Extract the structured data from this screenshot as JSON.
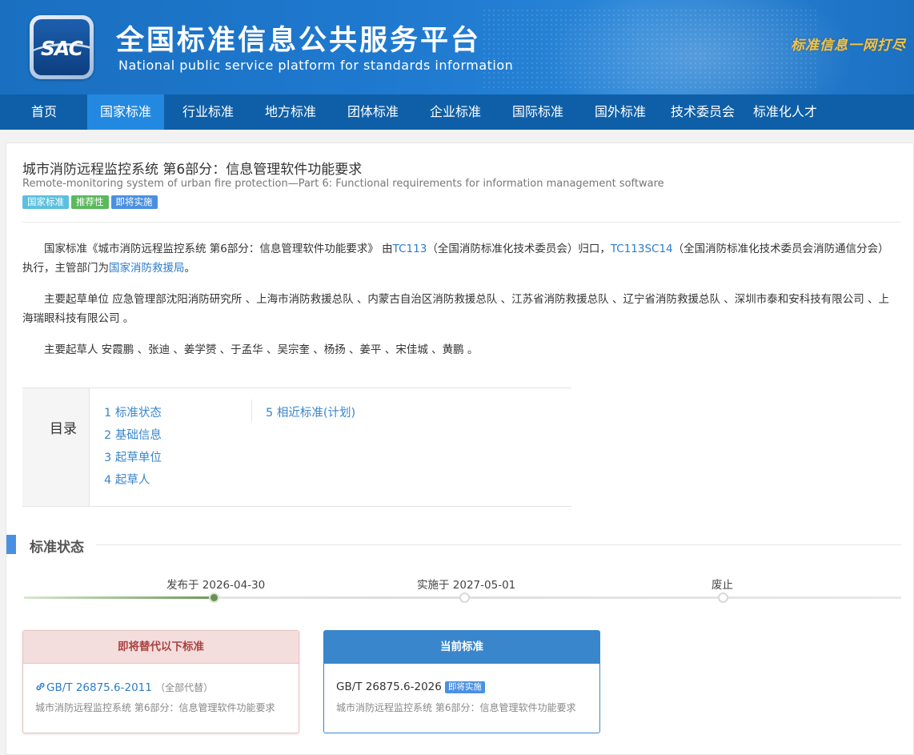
{
  "header": {
    "logo_text": "SAC",
    "title": "全国标准信息公共服务平台",
    "subtitle": "National public service platform  for standards information",
    "slogan": "标准信息一网打尽"
  },
  "nav": {
    "items": [
      {
        "label": "首页"
      },
      {
        "label": "国家标准"
      },
      {
        "label": "行业标准"
      },
      {
        "label": "地方标准"
      },
      {
        "label": "团体标准"
      },
      {
        "label": "企业标准"
      },
      {
        "label": "国际标准"
      },
      {
        "label": "国外标准"
      },
      {
        "label": "技术委员会"
      },
      {
        "label": "标准化人才"
      }
    ],
    "active": "国家标准"
  },
  "standard": {
    "title_cn": "城市消防远程监控系统 第6部分：信息管理软件功能要求",
    "title_en": "Remote-monitoring system of urban fire protection—Part 6: Functional requirements for information management software",
    "tags": [
      "国家标准",
      "推荐性",
      "即将实施"
    ]
  },
  "intro": {
    "p1_a": "国家标准《城市消防远程监控系统 第6部分：信息管理软件功能要求》 由",
    "p1_tc": "TC113",
    "p1_b": "（全国消防标准化技术委员会）归口，",
    "p1_sc": "TC113SC14",
    "p1_c": "（全国消防标准化技术委员会消防通信分会）执行，主管部门为",
    "p1_dept": "国家消防救援局",
    "p1_end": "。",
    "p2": "主要起草单位 应急管理部沈阳消防研究所 、上海市消防救援总队 、内蒙古自治区消防救援总队 、江苏省消防救援总队 、辽宁省消防救援总队 、深圳市泰和安科技有限公司 、上海瑞眼科技有限公司 。",
    "p3": "主要起草人 安霞鹏 、张迪 、姜学赟 、于孟华 、吴宗奎 、杨扬 、姜平 、宋佳城 、黄鹏 。"
  },
  "toc": {
    "label": "目录",
    "items": [
      "1  标准状态",
      "2  基础信息",
      "3  起草单位",
      "4  起草人",
      "5  相近标准(计划)"
    ]
  },
  "status_section": {
    "title": "标准状态",
    "timeline": [
      {
        "label": "发布于 2026-04-30",
        "done": true
      },
      {
        "label": "实施于 2027-05-01",
        "done": false
      },
      {
        "label": "废止",
        "done": false
      }
    ]
  },
  "replace_box": {
    "header": "即将替代以下标准",
    "std_num": "GB/T 26875.6-2011",
    "scope": "（全部代替）",
    "desc": "城市消防远程监控系统 第6部分：信息管理软件功能要求"
  },
  "current_box": {
    "header": "当前标准",
    "std_num": "GB/T 26875.6-2026",
    "badge": "即将实施",
    "desc": "城市消防远程监控系统 第6部分：信息管理软件功能要求"
  },
  "colors": {
    "header_blue": "#1f7ad0",
    "nav_blue": "#0f5fa8",
    "nav_active": "#2389e0",
    "link": "#2d7cc9",
    "accent": "#4a90e2"
  }
}
